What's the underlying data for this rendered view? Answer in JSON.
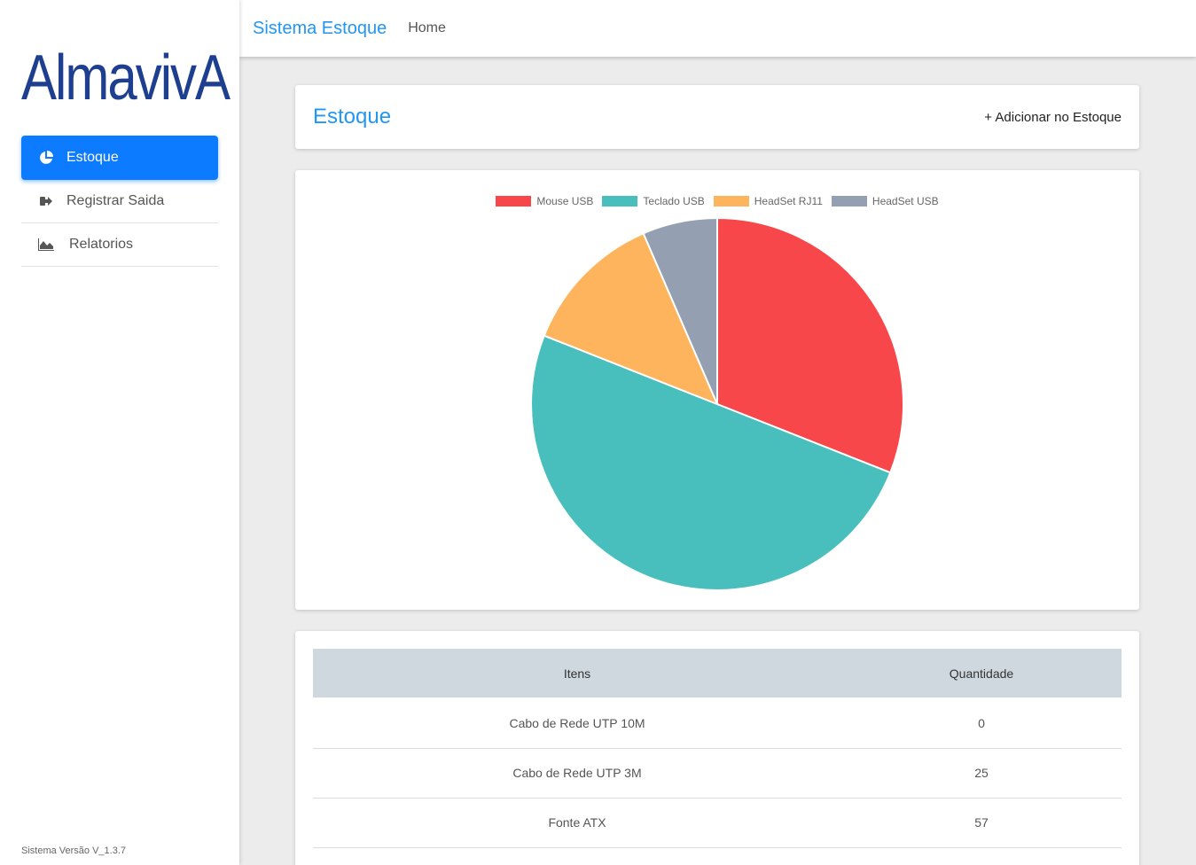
{
  "logo": {
    "text": "AlmavivA"
  },
  "sidebar": {
    "items": [
      {
        "label": "Estoque",
        "icon": "pie-chart-icon",
        "active": true
      },
      {
        "label": "Registrar Saida",
        "icon": "sign-out-icon",
        "active": false
      },
      {
        "label": "Relatorios",
        "icon": "area-chart-icon",
        "active": false
      }
    ],
    "version": "Sistema Versão V_1.3.7"
  },
  "topbar": {
    "brand": "Sistema Estoque",
    "home": "Home"
  },
  "header": {
    "title": "Estoque",
    "add_label": "+ Adicionar no Estoque"
  },
  "colors": {
    "accent": "#2196f3",
    "active_nav": "#0d7bff"
  },
  "chart_data": {
    "type": "pie",
    "labels": [
      "Mouse USB",
      "Teclado USB",
      "HeadSet RJ11",
      "HeadSet USB"
    ],
    "values": [
      31,
      50,
      12.5,
      6.5
    ],
    "colors": [
      "#f7474b",
      "#48bfbc",
      "#fdb45c",
      "#949fb1"
    ],
    "legend": "top"
  },
  "table": {
    "headers": [
      "Itens",
      "Quantidade"
    ],
    "rows": [
      [
        "Cabo de Rede UTP 10M",
        "0"
      ],
      [
        "Cabo de Rede UTP 3M",
        "25"
      ],
      [
        "Fonte ATX",
        "57"
      ]
    ]
  }
}
